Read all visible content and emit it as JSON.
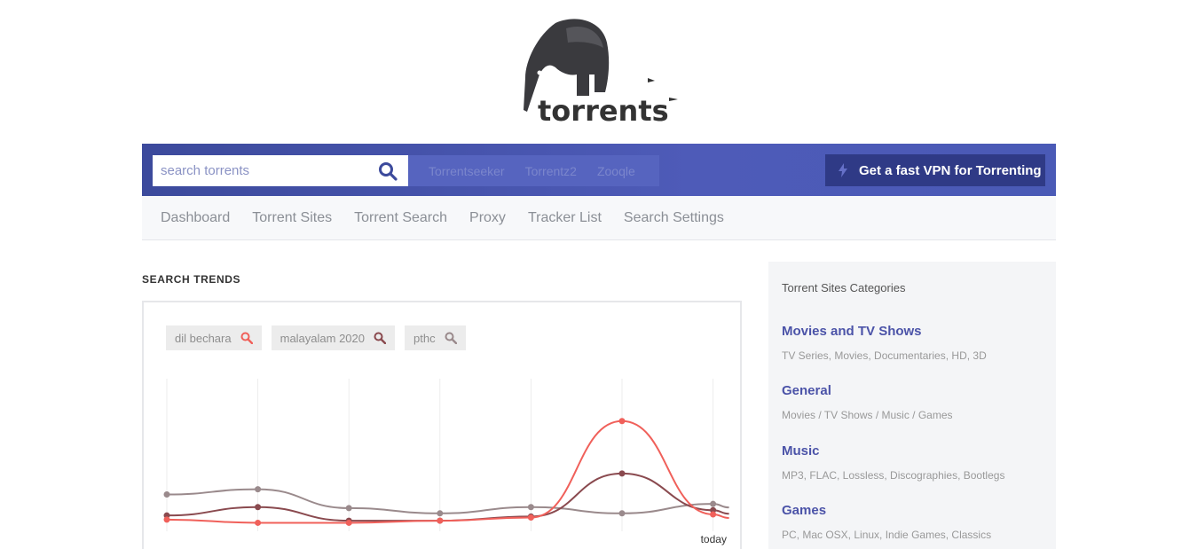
{
  "logo": {
    "text": "torrents"
  },
  "search": {
    "placeholder": "search torrents"
  },
  "engines": [
    "Torrentseeker",
    "Torrentz2",
    "Zooqle"
  ],
  "vpn": {
    "label": "Get a fast VPN for Torrenting"
  },
  "nav": [
    "Dashboard",
    "Torrent Sites",
    "Torrent Search",
    "Proxy",
    "Tracker List",
    "Search Settings"
  ],
  "trends": {
    "title": "SEARCH TRENDS",
    "tags": [
      {
        "label": "dil bechara",
        "color": "#f0605a"
      },
      {
        "label": "malayalam 2020",
        "color": "#8a4a4f"
      },
      {
        "label": "pthc",
        "color": "#9a8a8c"
      }
    ]
  },
  "chart_data": {
    "type": "line",
    "x": [
      "",
      "",
      "",
      "",
      "",
      "",
      "today"
    ],
    "series": [
      {
        "name": "dil bechara",
        "color": "#f0605a",
        "values": [
          6,
          3,
          3,
          5,
          8,
          100,
          11
        ]
      },
      {
        "name": "malayalam 2020",
        "color": "#8a4a4f",
        "values": [
          10,
          18,
          5,
          5,
          9,
          50,
          15
        ]
      },
      {
        "name": "pthc",
        "color": "#9a8a8c",
        "values": [
          30,
          35,
          17,
          12,
          18,
          12,
          21
        ]
      }
    ],
    "ylim": [
      0,
      115
    ],
    "grid": "vertical"
  },
  "sidebar": {
    "title": "Torrent Sites Categories",
    "categories": [
      {
        "name": "Movies and TV Shows",
        "desc": "TV Series, Movies, Documentaries, HD, 3D"
      },
      {
        "name": "General",
        "desc": "Movies / TV Shows / Music / Games"
      },
      {
        "name": "Music",
        "desc": "MP3, FLAC, Lossless, Discographies, Bootlegs"
      },
      {
        "name": "Games",
        "desc": "PC, Mac OSX, Linux, Indie Games, Classics"
      }
    ]
  }
}
